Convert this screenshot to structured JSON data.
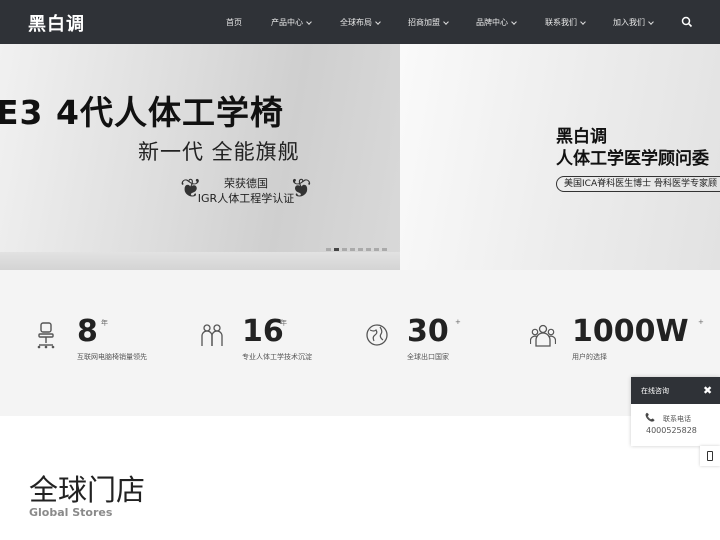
{
  "nav": {
    "logo": "黑白调",
    "items": [
      {
        "label": "首页",
        "dropdown": false
      },
      {
        "label": "产品中心",
        "dropdown": true
      },
      {
        "label": "全球布局",
        "dropdown": true
      },
      {
        "label": "招商加盟",
        "dropdown": true
      },
      {
        "label": "品牌中心",
        "dropdown": true
      },
      {
        "label": "联系我们",
        "dropdown": true
      },
      {
        "label": "加入我们",
        "dropdown": true
      }
    ],
    "search_icon": "search-icon"
  },
  "hero": {
    "left": {
      "title": "E3 4代人体工学椅",
      "subtitle": "新一代  全能旗舰",
      "award_line1": "荣获德国",
      "award_line2": "IGR人体工程学认证"
    },
    "right": {
      "brand": "黑白调",
      "title": "人体工学医学顾问委",
      "badge": "美国ICA脊科医生博士  骨科医学专家顾"
    },
    "carousel": {
      "count": 8,
      "active_index": 1
    }
  },
  "stats": [
    {
      "icon": "office-chair-icon",
      "number": "8",
      "unit": "年",
      "desc": "互联网电脑椅销量领先"
    },
    {
      "icon": "experts-icon",
      "number": "16",
      "unit": "年",
      "desc": "专业人体工学技术沉淀"
    },
    {
      "icon": "globe-icon",
      "number": "30",
      "unit": "+",
      "desc": "全球出口国家"
    },
    {
      "icon": "users-icon",
      "number": "1000W",
      "unit": "+",
      "desc": "用户的选择"
    }
  ],
  "float_panel": {
    "title": "在线咨询",
    "close": "✖",
    "phone_label": "联系电话",
    "phone_number": "4000525828"
  },
  "stores": {
    "title": "全球门店",
    "subtitle": "Global Stores"
  }
}
